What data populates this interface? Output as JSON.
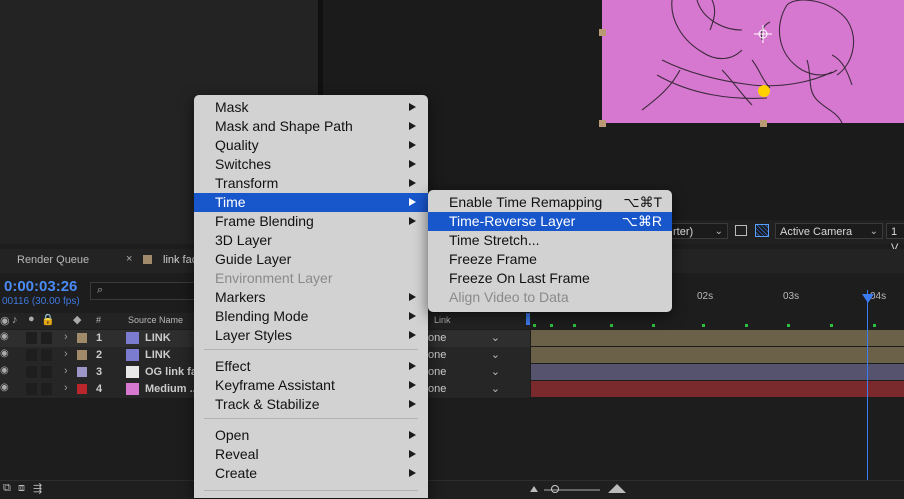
{
  "panels": {
    "render_queue_tab": "Render Queue",
    "comp_tab": "link fac",
    "close_glyph": "×"
  },
  "viewer": {
    "resolution_value": "rter)",
    "camera_value": "Active Camera",
    "view_value": "1 V"
  },
  "timeline": {
    "timecode": "0:00:03:26",
    "frame_info": "00116 (30.00 fps)",
    "col_hash": "#",
    "col_source": "Source Name",
    "col_parent": "Link",
    "ruler": [
      "02s",
      "03s",
      "04s"
    ],
    "layers": [
      {
        "num": "1",
        "name": "LINK",
        "parent": "one",
        "label_color": "#a08a6a",
        "track_color": "#6b6148"
      },
      {
        "num": "2",
        "name": "LINK",
        "parent": "one",
        "label_color": "#a08a6a",
        "track_color": "#6b6148"
      },
      {
        "num": "3",
        "name": "OG link fa",
        "parent": "one",
        "label_color": "#9b95c8",
        "track_color": "#55536e"
      },
      {
        "num": "4",
        "name": "Medium ...",
        "parent": "one",
        "label_color": "#b9262b",
        "track_color": "#7a2a2c"
      }
    ]
  },
  "context_menu": {
    "items": [
      {
        "label": "Mask",
        "submenu": true
      },
      {
        "label": "Mask and Shape Path",
        "submenu": true
      },
      {
        "label": "Quality",
        "submenu": true
      },
      {
        "label": "Switches",
        "submenu": true
      },
      {
        "label": "Transform",
        "submenu": true
      },
      {
        "label": "Time",
        "submenu": true,
        "selected": true
      },
      {
        "label": "Frame Blending",
        "submenu": true
      },
      {
        "label": "3D Layer"
      },
      {
        "label": "Guide Layer"
      },
      {
        "label": "Environment Layer",
        "disabled": true
      },
      {
        "label": "Markers",
        "submenu": true
      },
      {
        "label": "Blending Mode",
        "submenu": true
      },
      {
        "label": "Layer Styles",
        "submenu": true
      },
      {
        "label": "Effect",
        "submenu": true
      },
      {
        "label": "Keyframe Assistant",
        "submenu": true
      },
      {
        "label": "Track & Stabilize",
        "submenu": true
      },
      {
        "label": "Open",
        "submenu": true
      },
      {
        "label": "Reveal",
        "submenu": true
      },
      {
        "label": "Create",
        "submenu": true
      }
    ]
  },
  "time_submenu": {
    "items": [
      {
        "label": "Enable Time Remapping",
        "shortcut": "⌥⌘T"
      },
      {
        "label": "Time-Reverse Layer",
        "shortcut": "⌥⌘R",
        "selected": true
      },
      {
        "label": "Time Stretch..."
      },
      {
        "label": "Freeze Frame"
      },
      {
        "label": "Freeze On Last Frame"
      },
      {
        "label": "Align Video to Data",
        "disabled": true
      }
    ]
  },
  "colors": {
    "accent": "#1856cc",
    "canvas": "#d778d0",
    "playhead": "#3d7bf0"
  }
}
